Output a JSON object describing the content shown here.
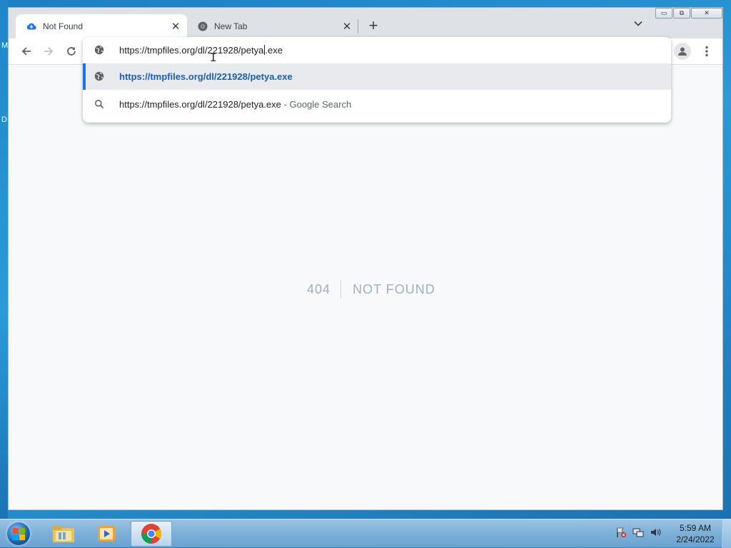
{
  "desktop": {
    "edge_letters": [
      "M",
      "D"
    ]
  },
  "browser": {
    "tabs": [
      {
        "title": "Not Found",
        "favicon": "cloud-icon",
        "active": true
      },
      {
        "title": "New Tab",
        "favicon": "chrome-icon",
        "active": false
      }
    ],
    "new_tab_symbol": "+",
    "tab_menu_symbol": "⌄",
    "window_controls": {
      "minimize": "▭",
      "maximize": "⧉",
      "close": "✕"
    }
  },
  "omnibox": {
    "input_before_caret": "https://tmpfiles.org/dl/221928/petya",
    "input_after_caret": ".exe",
    "suggestions": [
      {
        "icon": "globe-icon",
        "text": "https://tmpfiles.org/dl/221928/petya.exe",
        "suffix": "",
        "selected": true
      },
      {
        "icon": "search-icon",
        "text": "https://tmpfiles.org/dl/221928/petya.exe",
        "suffix": " - Google Search",
        "selected": false
      }
    ]
  },
  "page": {
    "code": "404",
    "message": "NOT FOUND"
  },
  "taskbar": {
    "clock_time": "5:59 AM",
    "clock_date": "2/24/2022",
    "pinned": [
      "file-explorer-icon",
      "media-player-icon",
      "chrome-icon"
    ]
  },
  "colors": {
    "accent": "#1a73e8",
    "selected_link": "#1a5fb4",
    "notfound_text": "#a0aec0"
  }
}
